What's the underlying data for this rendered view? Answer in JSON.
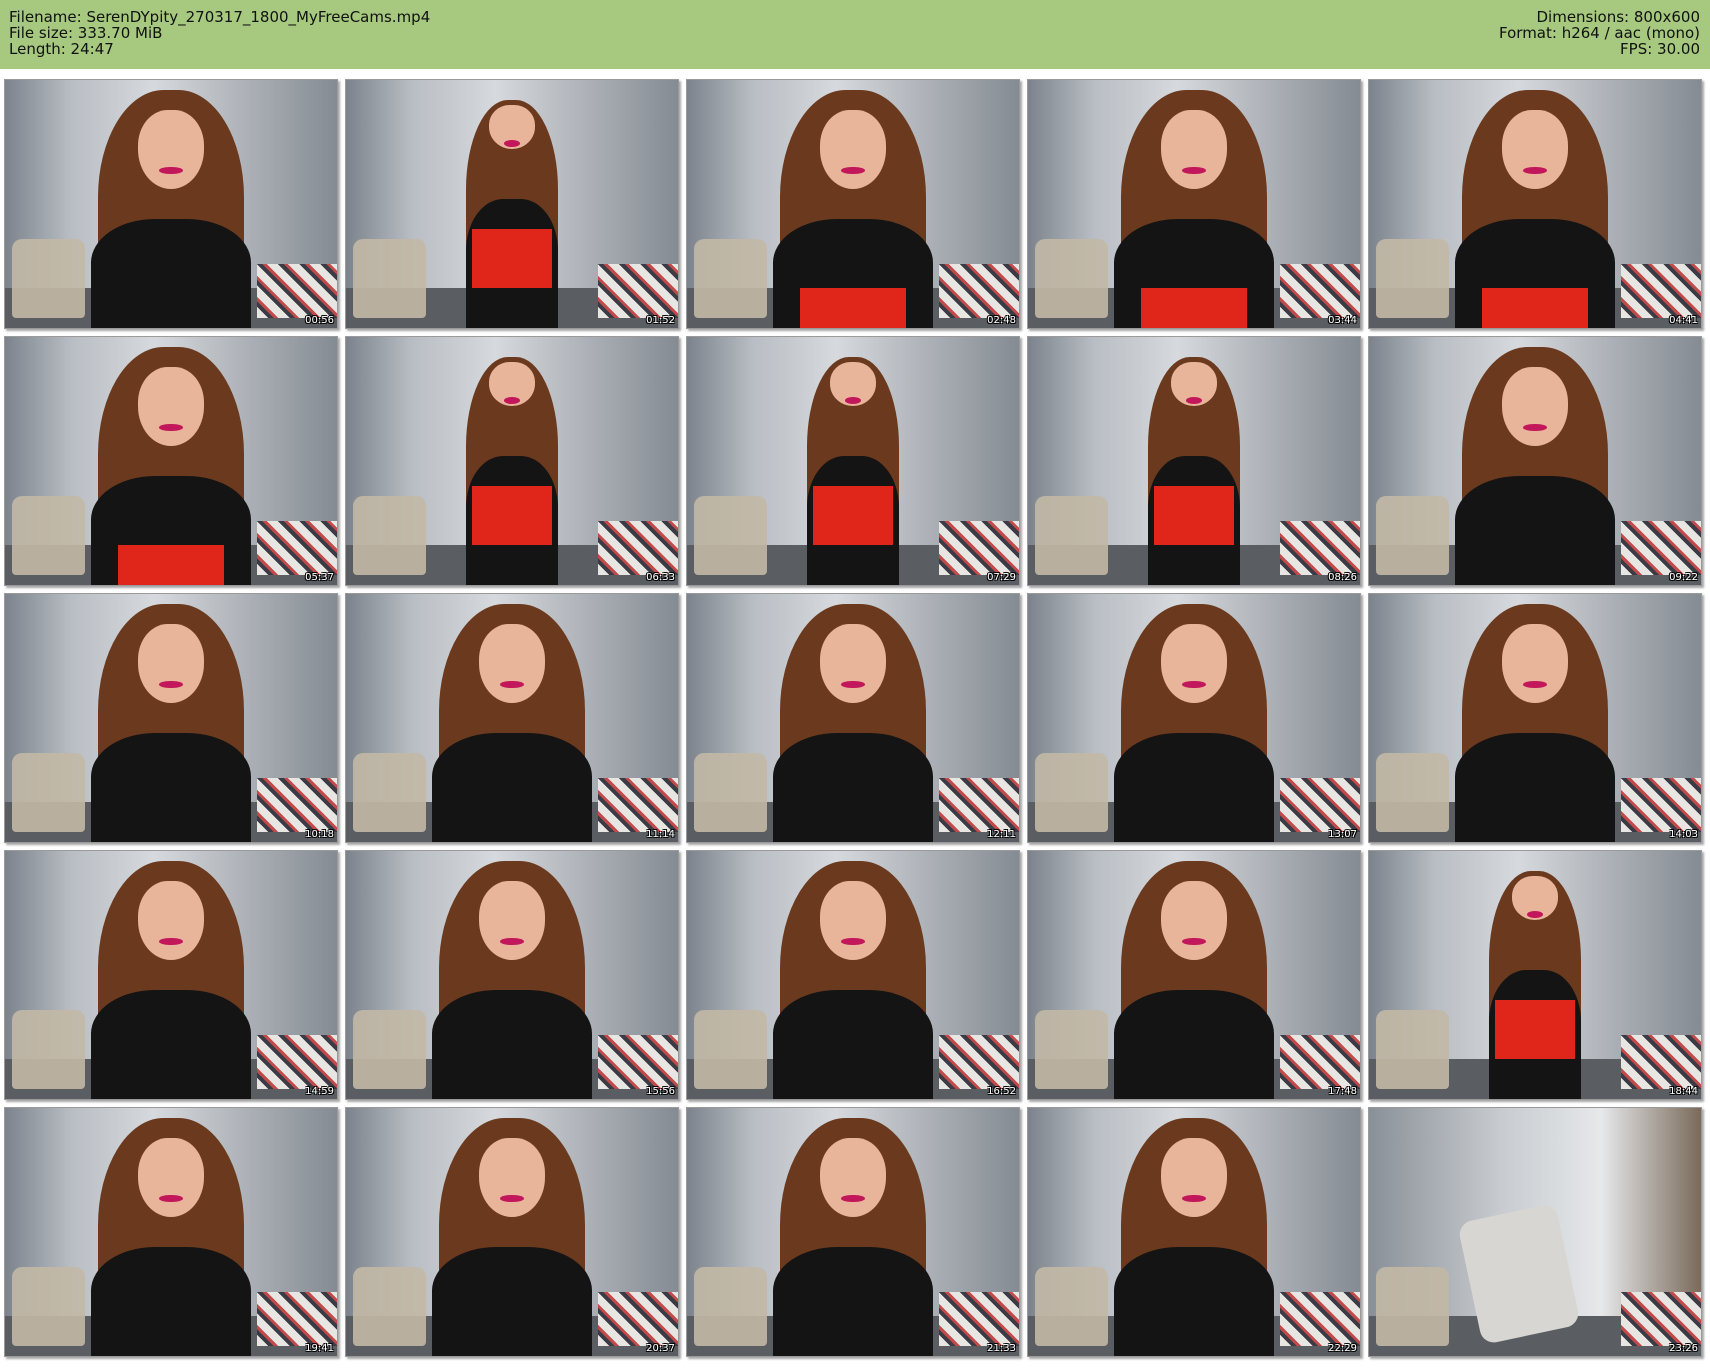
{
  "header": {
    "filename": "Filename: SerenDYpity_270317_1800_MyFreeCams.mp4",
    "filesize": "File size: 333.70 MiB",
    "length": "Length: 24:47",
    "dimensions": "Dimensions: 800x600",
    "format": "Format: h264 / aac (mono)",
    "fps": "FPS: 30.00"
  },
  "colors": {
    "header_bg": "#a6c87f",
    "timestamp_text": "#ffffff"
  },
  "thumbnails": [
    {
      "time": "00:56"
    },
    {
      "time": "01:52"
    },
    {
      "time": "02:48"
    },
    {
      "time": "03:44"
    },
    {
      "time": "04:41"
    },
    {
      "time": "05:37"
    },
    {
      "time": "06:33"
    },
    {
      "time": "07:29"
    },
    {
      "time": "08:26"
    },
    {
      "time": "09:22"
    },
    {
      "time": "10:18"
    },
    {
      "time": "11:14"
    },
    {
      "time": "12:11"
    },
    {
      "time": "13:07"
    },
    {
      "time": "14:03"
    },
    {
      "time": "14:59"
    },
    {
      "time": "15:56"
    },
    {
      "time": "16:52"
    },
    {
      "time": "17:48"
    },
    {
      "time": "18:44"
    },
    {
      "time": "19:41"
    },
    {
      "time": "20:37"
    },
    {
      "time": "21:33"
    },
    {
      "time": "22:29"
    },
    {
      "time": "23:26"
    }
  ]
}
